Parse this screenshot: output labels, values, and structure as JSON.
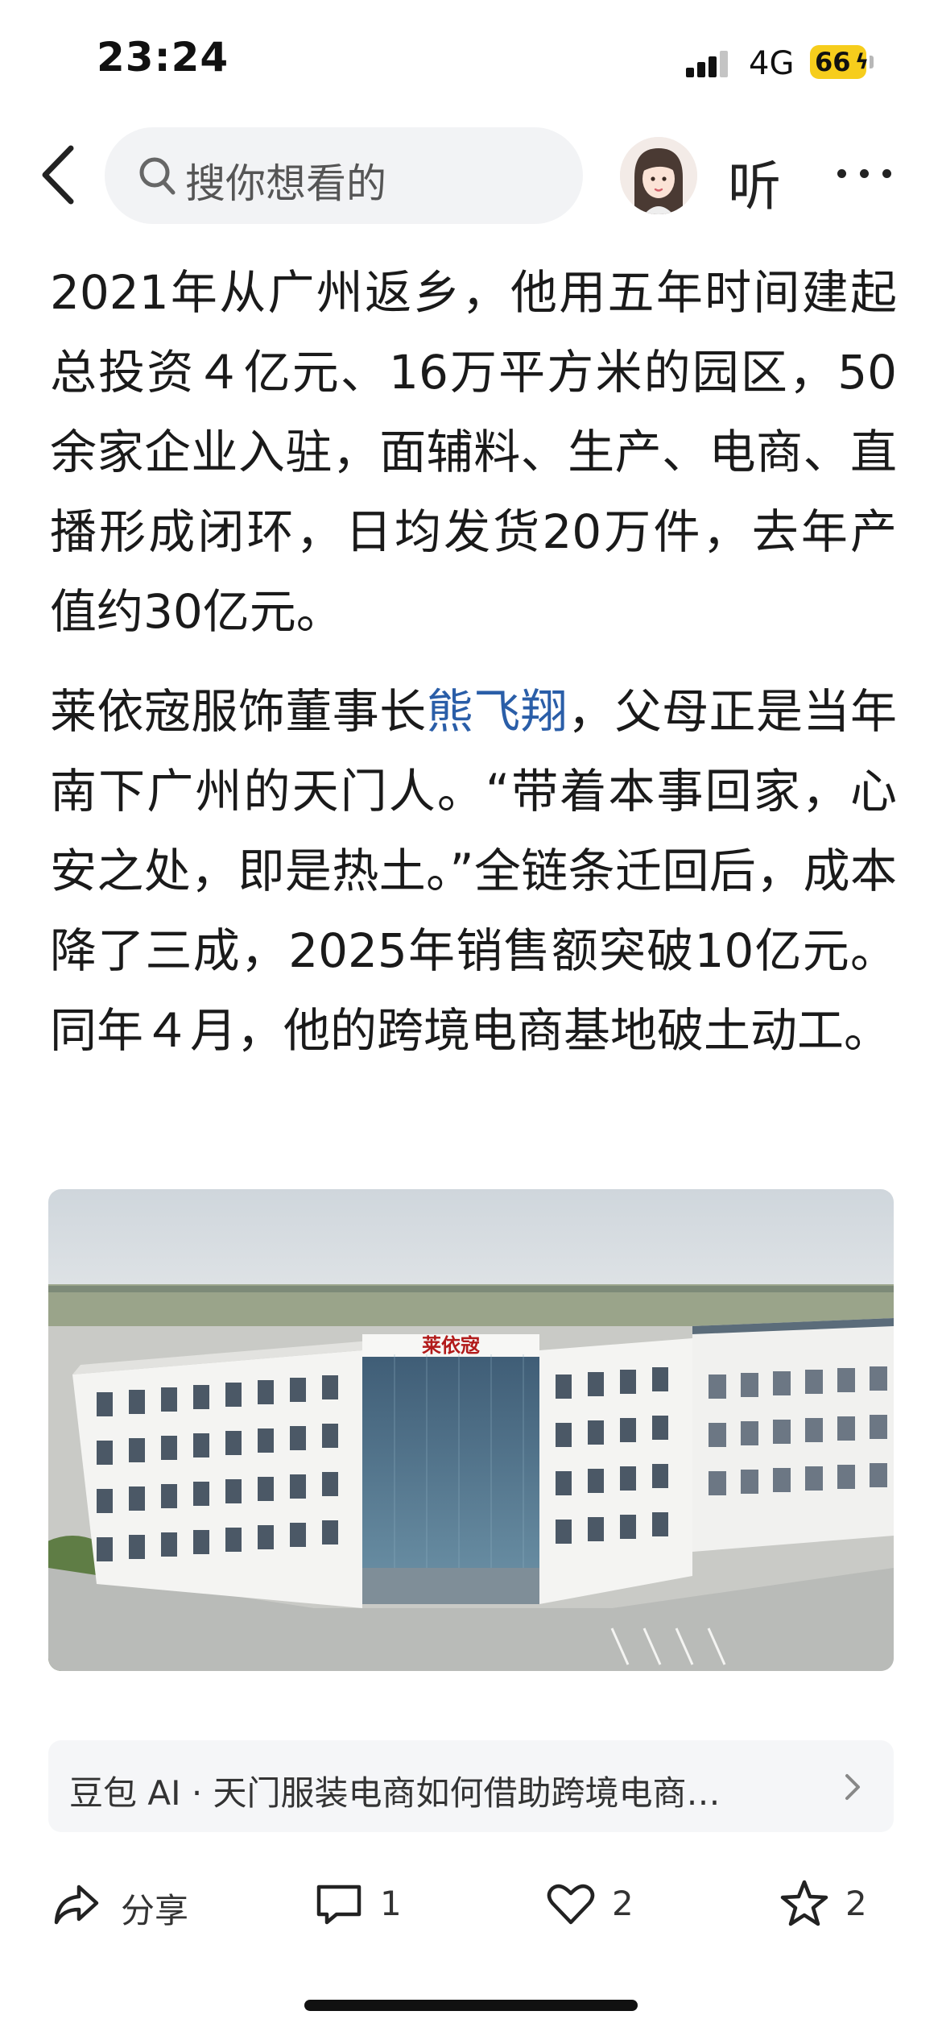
{
  "status_bar": {
    "time": "23:24",
    "network": "4G",
    "battery": "66"
  },
  "nav": {
    "search_placeholder": "搜你想看的",
    "listen_label": "听",
    "back_icon": "chevron-left-icon",
    "more_icon": "ellipsis-icon"
  },
  "article": {
    "para1": "2021年从广州返乡，他用五年时间建起总投资４亿元、16万平方米的园区，50余家企业入驻，面辅料、生产、电商、直播形成闭环，日均发货20万件，去年产值约30亿元。",
    "para2_before": "莱依宼服饰董事长",
    "para2_link": "熊飞翔",
    "para2_after": "，父母正是当年南下广州的天门人。“带着本事回家，心安之处，即是热土。”全链条迁回后，成本降了三成，2025年销售额突破10亿元。同年４月，他的跨境电商基地破土动工。",
    "image_sign": "莱依宼"
  },
  "ai_suggestion": {
    "text": "豆包 AI · 天门服装电商如何借助跨境电商…"
  },
  "actions": {
    "share_label": "分享",
    "comment_count": "1",
    "like_count": "2",
    "favorite_count": "2"
  },
  "colors": {
    "link": "#2a5ea8",
    "battery": "#f6cd1c",
    "search_bg": "#f2f3f5"
  }
}
